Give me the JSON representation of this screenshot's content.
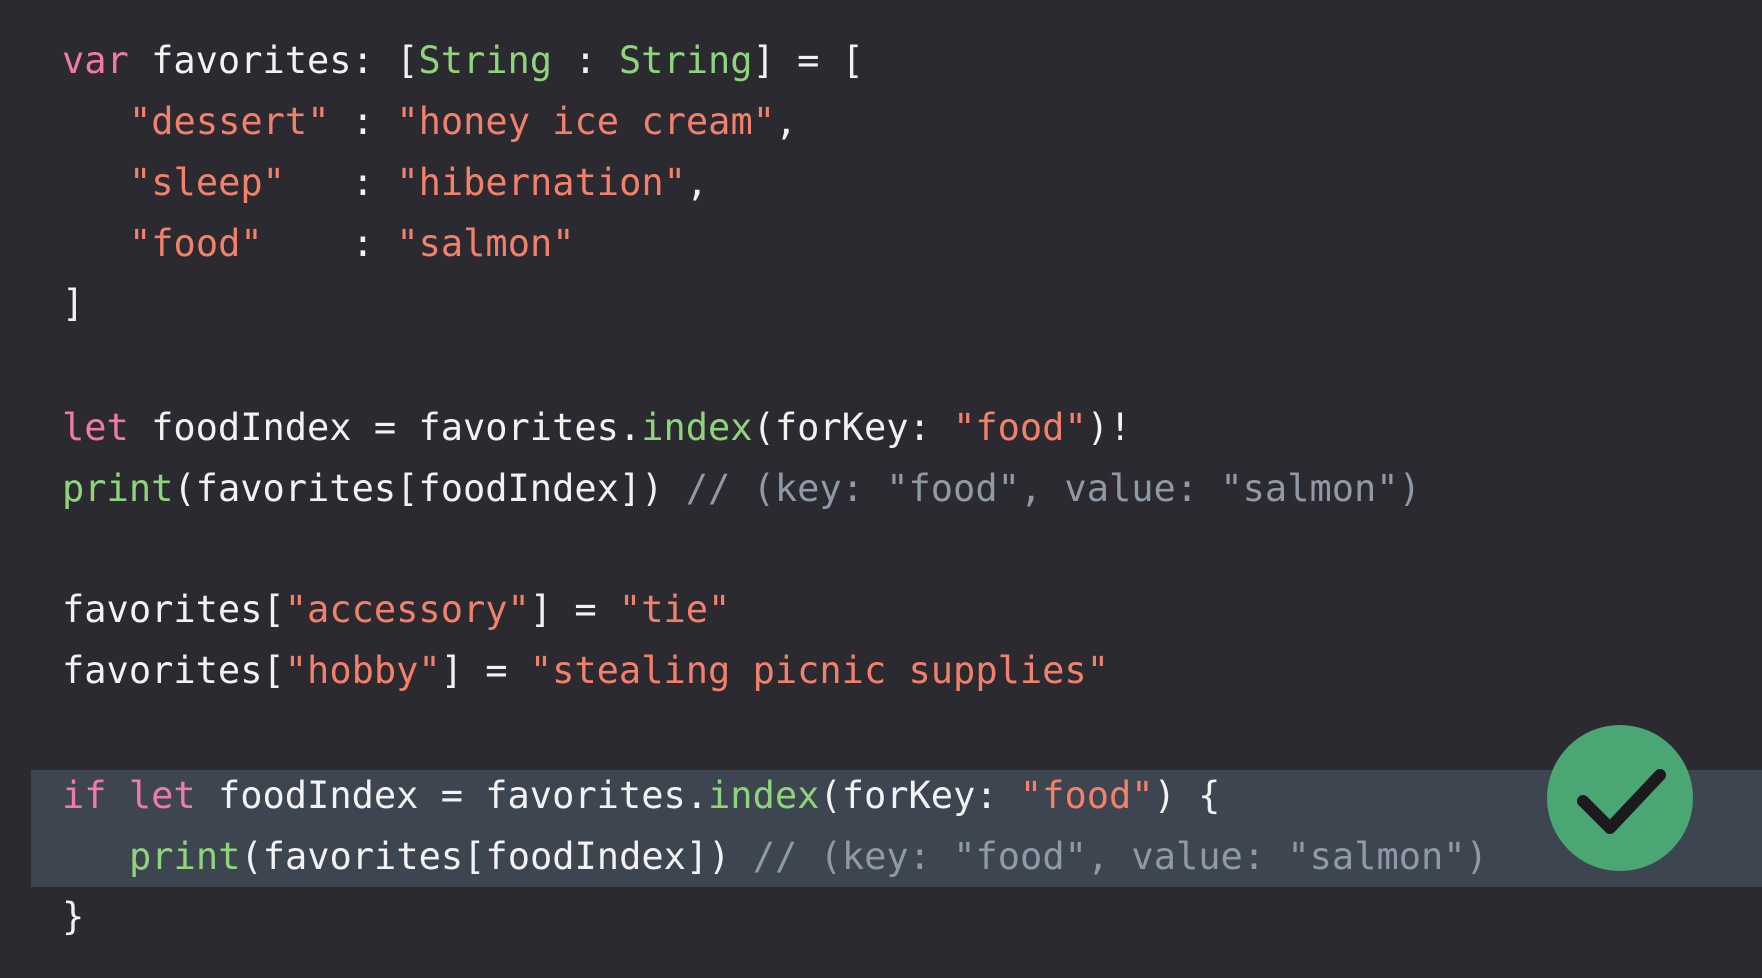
{
  "code": {
    "line1": {
      "var": "var",
      "decl": " favorites: [",
      "type1": "String",
      "sep": " : ",
      "type2": "String",
      "tail": "] = ["
    },
    "line2": {
      "key": "\"dessert\"",
      "colon": " : ",
      "value": "\"honey ice cream\"",
      "comma": ","
    },
    "line3": {
      "key": "\"sleep\"",
      "colon": "   : ",
      "value": "\"hibernation\"",
      "comma": ","
    },
    "line4": {
      "key": "\"food\"",
      "colon": "    : ",
      "value": "\"salmon\""
    },
    "line5": {
      "close": "]"
    },
    "line6": {
      "let": "let",
      "a": " foodIndex = favorites.",
      "fn": "index",
      "b": "(forKey: ",
      "str": "\"food\"",
      "c": ")!"
    },
    "line7": {
      "fn": "print",
      "a": "(favorites[foodIndex])",
      "comment": " // (key: \"food\", value: \"salmon\")"
    },
    "line8": {
      "a": "favorites[",
      "key": "\"accessory\"",
      "b": "] = ",
      "value": "\"tie\""
    },
    "line9": {
      "a": "favorites[",
      "key": "\"hobby\"",
      "b": "] = ",
      "value": "\"stealing picnic supplies\""
    },
    "line10": {
      "if": "if",
      "let": "let",
      "a": " foodIndex = favorites.",
      "fn": "index",
      "b": "(forKey: ",
      "str": "\"food\"",
      "c": ") {"
    },
    "line11": {
      "fn": "print",
      "a": "(favorites[foodIndex])",
      "comment": " // (key: \"food\", value: \"salmon\")"
    },
    "line12": {
      "close": "}"
    }
  },
  "badge": {
    "icon": "checkmark-icon",
    "color": "#4aa673"
  },
  "colors": {
    "background": "#2a2a30",
    "highlight": "#3d4650",
    "keyword": "#f07aa3",
    "type": "#8fd47a",
    "string": "#f2806a",
    "comment": "#8f9aa6",
    "plain": "#f2f2f2"
  }
}
